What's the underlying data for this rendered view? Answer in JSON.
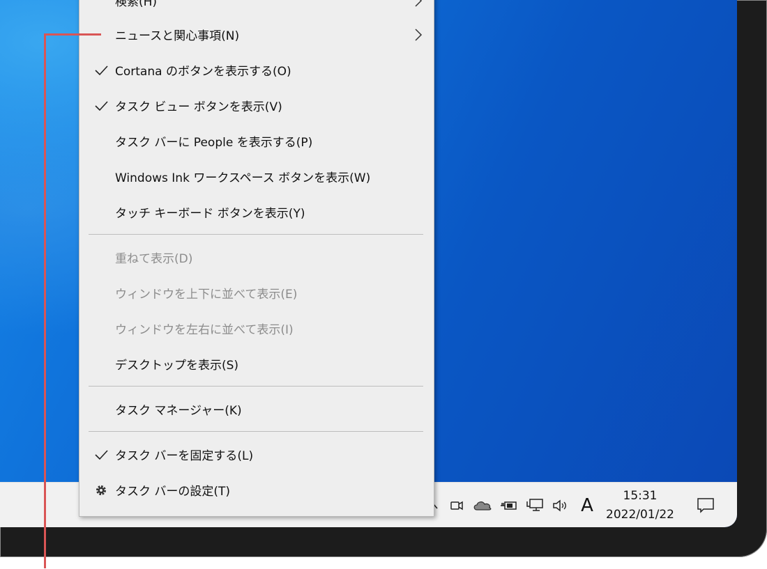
{
  "menu": {
    "items": [
      {
        "label": "検索(H)",
        "checked": false,
        "disabled": false,
        "submenu": true
      },
      {
        "label": "ニュースと関心事項(N)",
        "checked": false,
        "disabled": false,
        "submenu": true
      },
      {
        "label": "Cortana のボタンを表示する(O)",
        "checked": true,
        "disabled": false,
        "submenu": false
      },
      {
        "label": "タスク ビュー ボタンを表示(V)",
        "checked": true,
        "disabled": false,
        "submenu": false
      },
      {
        "label": "タスク バーに People を表示する(P)",
        "checked": false,
        "disabled": false,
        "submenu": false
      },
      {
        "label": "Windows Ink ワークスペース ボタンを表示(W)",
        "checked": false,
        "disabled": false,
        "submenu": false
      },
      {
        "label": "タッチ キーボード ボタンを表示(Y)",
        "checked": false,
        "disabled": false,
        "submenu": false
      },
      {
        "label": "重ねて表示(D)",
        "checked": false,
        "disabled": true,
        "submenu": false
      },
      {
        "label": "ウィンドウを上下に並べて表示(E)",
        "checked": false,
        "disabled": true,
        "submenu": false
      },
      {
        "label": "ウィンドウを左右に並べて表示(I)",
        "checked": false,
        "disabled": true,
        "submenu": false
      },
      {
        "label": "デスクトップを表示(S)",
        "checked": false,
        "disabled": false,
        "submenu": false
      },
      {
        "label": "タスク マネージャー(K)",
        "checked": false,
        "disabled": false,
        "submenu": false
      },
      {
        "label": "タスク バーを固定する(L)",
        "checked": true,
        "disabled": false,
        "submenu": false
      },
      {
        "label": "タスク バーの設定(T)",
        "checked": false,
        "disabled": false,
        "submenu": false,
        "icon": "gear-icon"
      }
    ]
  },
  "taskbar": {
    "tray_icons": [
      "chevron-up-icon",
      "meet-now-icon",
      "onedrive-cloud-icon",
      "power-plug-icon",
      "network-icon",
      "volume-icon"
    ],
    "ime_indicator": "A",
    "time": "15:31",
    "date": "2022/01/22",
    "notification_icon": "action-center-icon"
  },
  "colors": {
    "callout": "#d95555",
    "menu_bg": "#eeeeee",
    "taskbar_bg": "#f1f1f1",
    "desktop_blue": "#0f6fd8"
  }
}
